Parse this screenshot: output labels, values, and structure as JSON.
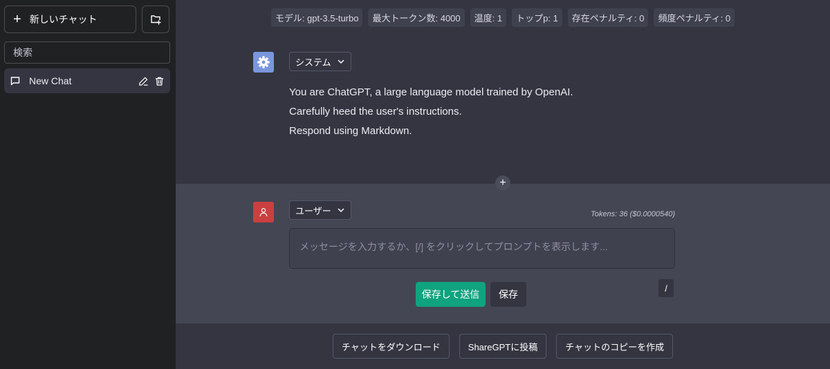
{
  "sidebar": {
    "new_chat_label": "新しいチャット",
    "search_placeholder": "検索",
    "chats": [
      {
        "label": "New Chat"
      }
    ]
  },
  "model_bar": {
    "model": "モデル: gpt-3.5-turbo",
    "max_tokens": "最大トークン数: 4000",
    "temperature": "温度: 1",
    "top_p": "トップp: 1",
    "presence_penalty": "存在ペナルティ: 0",
    "frequency_penalty": "頻度ペナルティ: 0"
  },
  "system_message": {
    "role_label": "システム",
    "lines": [
      "You are ChatGPT, a large language model trained by OpenAI.",
      "Carefully heed the user's instructions.",
      "Respond using Markdown."
    ]
  },
  "add_message_icon": "plus-icon",
  "user_message": {
    "role_label": "ユーザー",
    "tokens": "Tokens: 36 ($0.0000540)",
    "input_value": "",
    "input_placeholder": "メッセージを入力するか、[/] をクリックしてプロンプトを表示します...",
    "slash_label": "/",
    "save_send_label": "保存して送信",
    "save_label": "保存"
  },
  "footer": {
    "download_label": "チャットをダウンロード",
    "sharegpt_label": "ShareGPTに投稿",
    "copy_label": "チャットのコピーを作成"
  },
  "colors": {
    "sidebar_bg": "#202123",
    "main_bg": "#343541",
    "user_bg": "#444654",
    "accent_green": "#10a37f",
    "system_avatar": "#7a96dc",
    "user_avatar": "#c9403f"
  }
}
